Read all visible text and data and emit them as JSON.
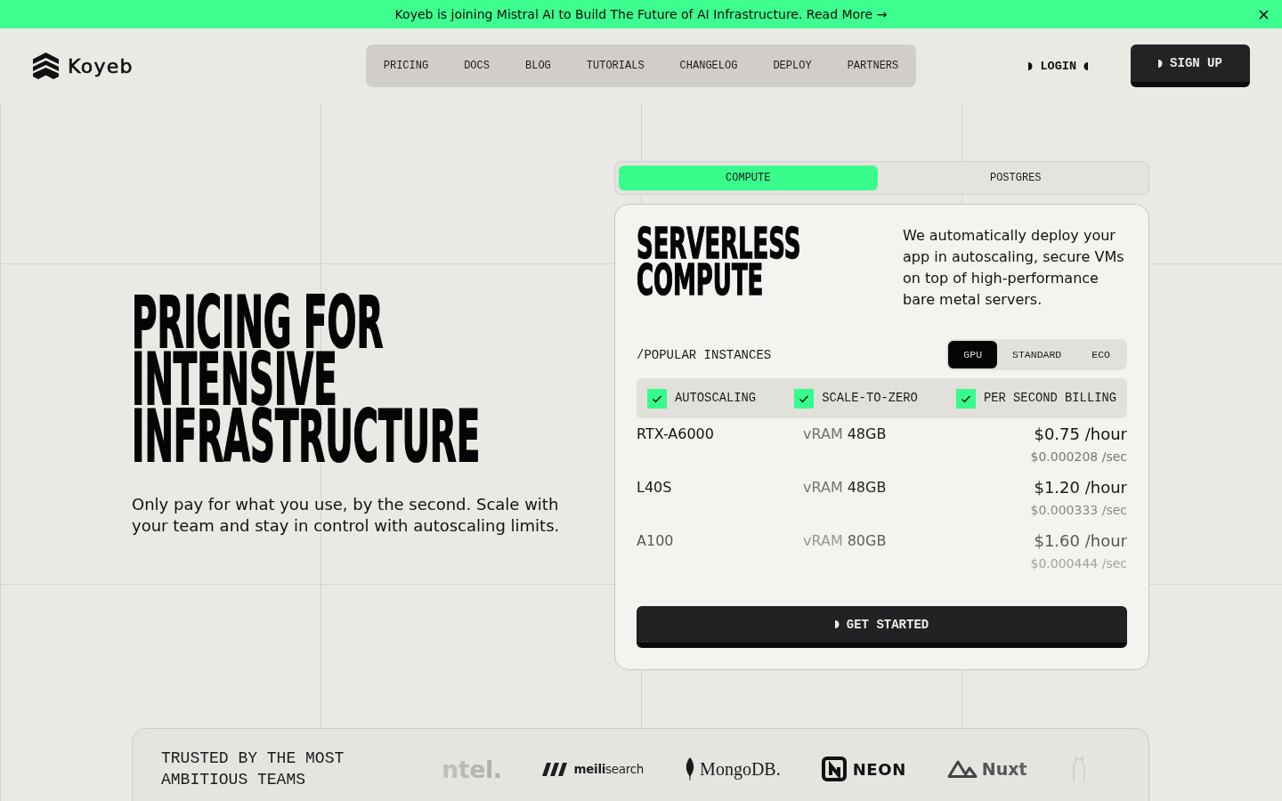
{
  "announcement": {
    "text": "Koyeb is joining Mistral AI to Build The Future of AI Infrastructure. Read More →"
  },
  "header": {
    "logo_text": "Koyeb",
    "nav": [
      "PRICING",
      "DOCS",
      "BLOG",
      "TUTORIALS",
      "CHANGELOG",
      "DEPLOY",
      "PARTNERS"
    ],
    "login": "LOGIN",
    "signup": "SIGN UP"
  },
  "hero": {
    "title": "PRICING FOR INTENSIVE INFRASTRUCTURE",
    "subtitle": "Only pay for what you use, by the second. Scale with your team and stay in control with autoscaling limits."
  },
  "pricing_card": {
    "tabs": [
      {
        "label": "COMPUTE",
        "selected": true
      },
      {
        "label": "POSTGRES",
        "selected": false
      }
    ],
    "title": "SERVERLESS COMPUTE",
    "description": "We automatically deploy your app in autoscaling, secure VMs on top of high-performance bare metal servers.",
    "section_label": "/POPULAR INSTANCES",
    "filters": [
      {
        "label": "GPU",
        "selected": true
      },
      {
        "label": "STANDARD",
        "selected": false
      },
      {
        "label": "ECO",
        "selected": false
      }
    ],
    "features": [
      {
        "label": "AUTOSCALING",
        "checked": true
      },
      {
        "label": "SCALE-TO-ZERO",
        "checked": true
      },
      {
        "label": "PER SECOND BILLING",
        "checked": true
      }
    ],
    "instances": [
      {
        "name": "RTX-A6000",
        "vram_label": "vRAM",
        "vram": "48GB",
        "price_hour": "$0.75 /hour",
        "price_sec": "$0.000208 /sec"
      },
      {
        "name": "L40S",
        "vram_label": "vRAM",
        "vram": "48GB",
        "price_hour": "$1.20 /hour",
        "price_sec": "$0.000333 /sec"
      },
      {
        "name": "A100",
        "vram_label": "vRAM",
        "vram": "80GB",
        "price_hour": "$1.60 /hour",
        "price_sec": "$0.000444 /sec"
      }
    ],
    "cta": "GET STARTED"
  },
  "trusted": {
    "heading": "TRUSTED BY THE MOST AMBITIOUS TEAMS",
    "logos": [
      {
        "kind": "wordmark",
        "text": "ntel."
      },
      {
        "kind": "stripes",
        "text": "**meili**search"
      },
      {
        "kind": "leaf",
        "text": "MongoDB."
      },
      {
        "kind": "square-n",
        "text": "NEON"
      },
      {
        "kind": "peaks",
        "text": "Nuxt"
      },
      {
        "kind": "llama"
      }
    ]
  }
}
